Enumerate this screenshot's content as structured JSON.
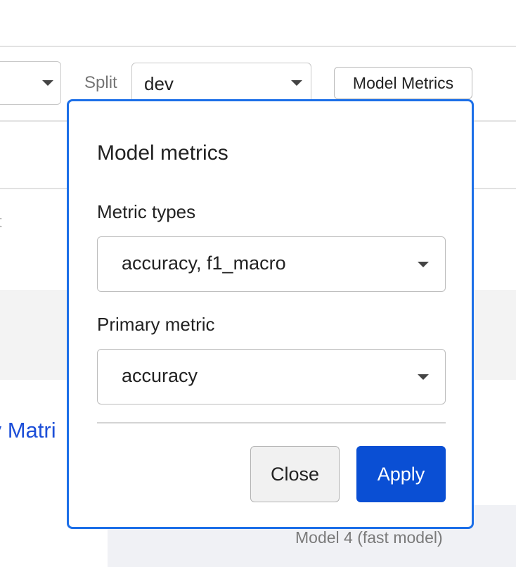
{
  "toolbar": {
    "split_label": "Split",
    "split_value": "dev",
    "model_metrics_button": "Model Metrics"
  },
  "background": {
    "link_text": "ty Matri",
    "faint_text": "t",
    "model_label": "Model 4 (fast model)"
  },
  "modal": {
    "title": "Model metrics",
    "metric_types_label": "Metric types",
    "metric_types_value": "accuracy, f1_macro",
    "primary_metric_label": "Primary metric",
    "primary_metric_value": "accuracy",
    "close_label": "Close",
    "apply_label": "Apply"
  },
  "colors": {
    "accent": "#1c6fe8",
    "primary_button": "#0a4fd4",
    "link": "#1d4fd8"
  },
  "icons": {
    "select_caret": "caret-down-icon"
  }
}
